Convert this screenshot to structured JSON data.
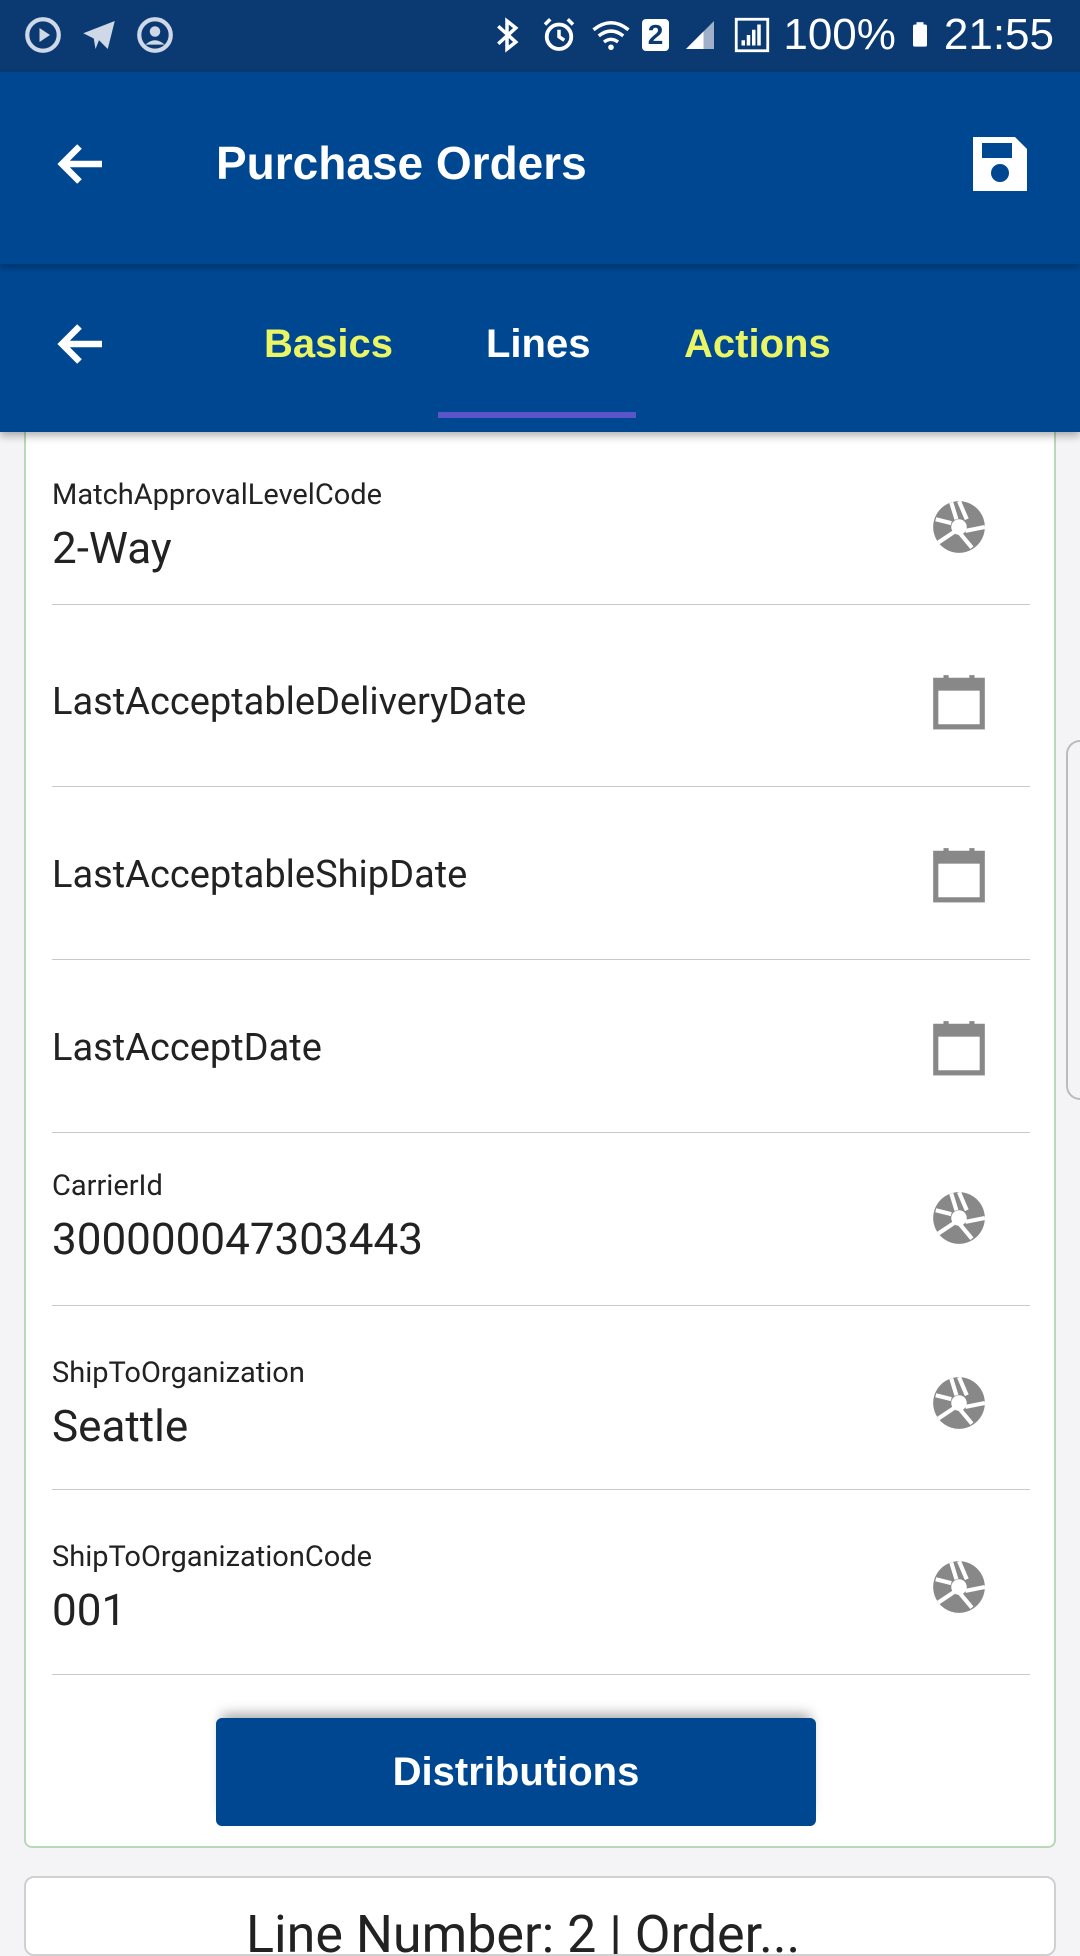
{
  "status_bar": {
    "battery": "100%",
    "time": "21:55",
    "network_badge": "2",
    "icons_left": [
      "play-circle-icon",
      "telegram-icon",
      "account-circle-icon"
    ],
    "icons_right": [
      "bluetooth-icon",
      "alarm-icon",
      "wifi-icon",
      "signal-icon",
      "battery-icon"
    ]
  },
  "app_bar": {
    "title": "Purchase Orders",
    "back_icon": "arrow-left-icon",
    "save_icon": "save-icon"
  },
  "tabs": {
    "items": [
      {
        "label": "Basics",
        "active": false
      },
      {
        "label": "Lines",
        "active": true
      },
      {
        "label": "Actions",
        "active": false
      }
    ],
    "active_color": "#ffffff",
    "inactive_color": "#e9f564"
  },
  "fields": [
    {
      "label": "MatchApprovalLevelCode",
      "value": "2-Way",
      "icon": "aperture-icon"
    },
    {
      "label": "",
      "value": "LastAcceptableDeliveryDate",
      "icon": "calendar-icon"
    },
    {
      "label": "",
      "value": "LastAcceptableShipDate",
      "icon": "calendar-icon"
    },
    {
      "label": "",
      "value": "LastAcceptDate",
      "icon": "calendar-icon"
    },
    {
      "label": "CarrierId",
      "value": "300000047303443",
      "icon": "aperture-icon"
    },
    {
      "label": "ShipToOrganization",
      "value": "Seattle",
      "icon": "aperture-icon"
    },
    {
      "label": "ShipToOrganizationCode",
      "value": "001",
      "icon": "aperture-icon"
    }
  ],
  "distributions_button": "Distributions",
  "next_card_peek": "Line Number: 2 | Order...",
  "colors": {
    "primary": "#004792",
    "statusbar": "#0b3a72",
    "tab_indicator": "#5a55c8",
    "card_border": "#b8d8b8"
  }
}
